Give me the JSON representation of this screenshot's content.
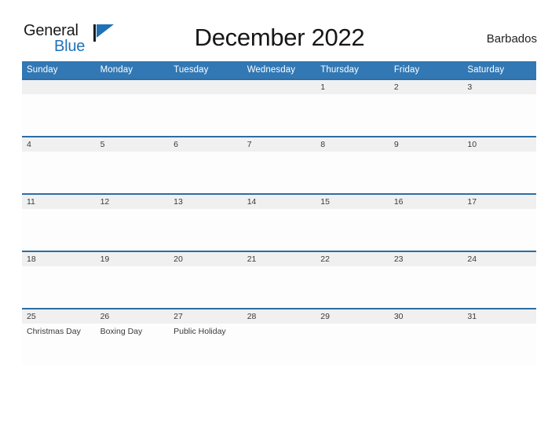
{
  "brand": {
    "line1": "General",
    "line2": "Blue",
    "flag_color": "#1f72b8",
    "icon": "flag-triangle-icon"
  },
  "header": {
    "title": "December 2022",
    "location": "Barbados"
  },
  "theme": {
    "header_blue": "#3178b5",
    "row_rule_blue": "#2e6da4",
    "date_band_gray": "#f0f0f0",
    "text_dark": "#3a3a3a"
  },
  "calendar": {
    "month": "December",
    "year": "2022",
    "weekday_headers": [
      "Sunday",
      "Monday",
      "Tuesday",
      "Wednesday",
      "Thursday",
      "Friday",
      "Saturday"
    ],
    "weeks": [
      [
        {
          "day": "",
          "event": ""
        },
        {
          "day": "",
          "event": ""
        },
        {
          "day": "",
          "event": ""
        },
        {
          "day": "",
          "event": ""
        },
        {
          "day": "1",
          "event": ""
        },
        {
          "day": "2",
          "event": ""
        },
        {
          "day": "3",
          "event": ""
        }
      ],
      [
        {
          "day": "4",
          "event": ""
        },
        {
          "day": "5",
          "event": ""
        },
        {
          "day": "6",
          "event": ""
        },
        {
          "day": "7",
          "event": ""
        },
        {
          "day": "8",
          "event": ""
        },
        {
          "day": "9",
          "event": ""
        },
        {
          "day": "10",
          "event": ""
        }
      ],
      [
        {
          "day": "11",
          "event": ""
        },
        {
          "day": "12",
          "event": ""
        },
        {
          "day": "13",
          "event": ""
        },
        {
          "day": "14",
          "event": ""
        },
        {
          "day": "15",
          "event": ""
        },
        {
          "day": "16",
          "event": ""
        },
        {
          "day": "17",
          "event": ""
        }
      ],
      [
        {
          "day": "18",
          "event": ""
        },
        {
          "day": "19",
          "event": ""
        },
        {
          "day": "20",
          "event": ""
        },
        {
          "day": "21",
          "event": ""
        },
        {
          "day": "22",
          "event": ""
        },
        {
          "day": "23",
          "event": ""
        },
        {
          "day": "24",
          "event": ""
        }
      ],
      [
        {
          "day": "25",
          "event": "Christmas Day"
        },
        {
          "day": "26",
          "event": "Boxing Day"
        },
        {
          "day": "27",
          "event": "Public Holiday"
        },
        {
          "day": "28",
          "event": ""
        },
        {
          "day": "29",
          "event": ""
        },
        {
          "day": "30",
          "event": ""
        },
        {
          "day": "31",
          "event": ""
        }
      ]
    ],
    "holidays": [
      {
        "date": "25",
        "name": "Christmas Day"
      },
      {
        "date": "26",
        "name": "Boxing Day"
      },
      {
        "date": "27",
        "name": "Public Holiday"
      }
    ]
  }
}
